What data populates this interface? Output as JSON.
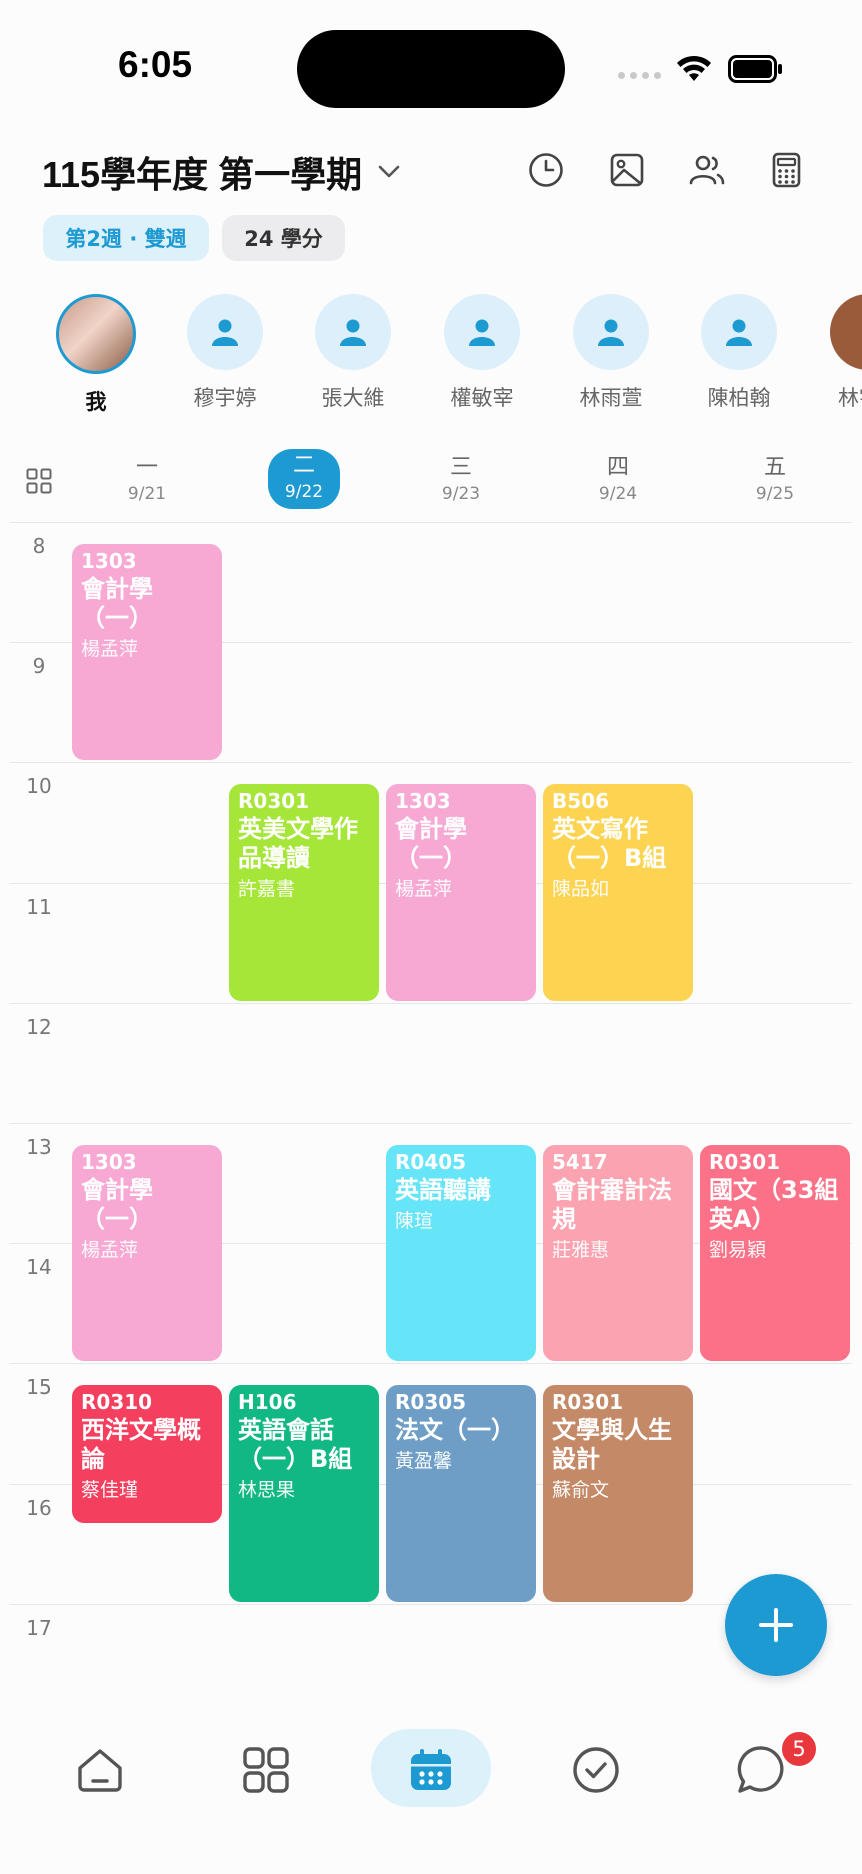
{
  "status_bar": {
    "time": "6:05"
  },
  "header": {
    "term_title": "115學年度 第一學期",
    "week_chip": "第2週 · 雙週",
    "credits_chip": "24 學分"
  },
  "friends": [
    {
      "name": "我"
    },
    {
      "name": "穆宇婷"
    },
    {
      "name": "張大維"
    },
    {
      "name": "權敏宰"
    },
    {
      "name": "林雨萱"
    },
    {
      "name": "陳柏翰"
    },
    {
      "name": "林宇"
    }
  ],
  "days": [
    {
      "day": "一",
      "date": "9/21"
    },
    {
      "day": "二",
      "date": "9/22"
    },
    {
      "day": "三",
      "date": "9/23"
    },
    {
      "day": "四",
      "date": "9/24"
    },
    {
      "day": "五",
      "date": "9/25"
    }
  ],
  "active_day_index": 1,
  "hours": [
    "8",
    "9",
    "10",
    "11",
    "12",
    "13",
    "14",
    "15",
    "16",
    "17"
  ],
  "courses": [
    {
      "day": 0,
      "start": 8,
      "end": 10,
      "room": "1303",
      "name": "會計學\n（一）",
      "teacher": "楊孟萍",
      "color": "#f7a8d3"
    },
    {
      "day": 1,
      "start": 10,
      "end": 12,
      "room": "R0301",
      "name": "英美文學作品導讀",
      "teacher": "許嘉書",
      "color": "#a5e639"
    },
    {
      "day": 2,
      "start": 10,
      "end": 12,
      "room": "1303",
      "name": "會計學\n（一）",
      "teacher": "楊孟萍",
      "color": "#f7a8d3"
    },
    {
      "day": 3,
      "start": 10,
      "end": 12,
      "room": "B506",
      "name": "英文寫作\n（一）B組",
      "teacher": "陳品如",
      "color": "#fcd451"
    },
    {
      "day": 0,
      "start": 13,
      "end": 15,
      "room": "1303",
      "name": "會計學\n（一）",
      "teacher": "楊孟萍",
      "color": "#f7a8d3"
    },
    {
      "day": 2,
      "start": 13,
      "end": 15,
      "room": "R0405",
      "name": "英語聽講",
      "teacher": "陳瑄",
      "color": "#67e5f8"
    },
    {
      "day": 3,
      "start": 13,
      "end": 15,
      "room": "5417",
      "name": "會計審計法規",
      "teacher": "莊雅惠",
      "color": "#fba3b0"
    },
    {
      "day": 4,
      "start": 13,
      "end": 15,
      "room": "R0301",
      "name": "國文（33組英A）",
      "teacher": "劉易穎",
      "color": "#fb7187"
    },
    {
      "day": 0,
      "start": 15,
      "end": 16.33,
      "room": "R0310",
      "name": "西洋文學概論",
      "teacher": "蔡佳瑾",
      "color": "#f43f5e"
    },
    {
      "day": 1,
      "start": 15,
      "end": 17,
      "room": "H106",
      "name": "英語會話\n（一）B組",
      "teacher": "林思果",
      "color": "#12b883"
    },
    {
      "day": 2,
      "start": 15,
      "end": 17,
      "room": "R0305",
      "name": "法文（一）",
      "teacher": "黃盈馨",
      "color": "#6e9ec6"
    },
    {
      "day": 3,
      "start": 15,
      "end": 17,
      "room": "R0301",
      "name": "文學與人生設計",
      "teacher": "蘇俞文",
      "color": "#c48a68"
    }
  ],
  "nav": {
    "items": [
      "home",
      "apps",
      "calendar",
      "tasks",
      "messages"
    ],
    "active": "calendar",
    "message_badge": "5"
  },
  "colors": {
    "accent": "#1e9ad3"
  }
}
